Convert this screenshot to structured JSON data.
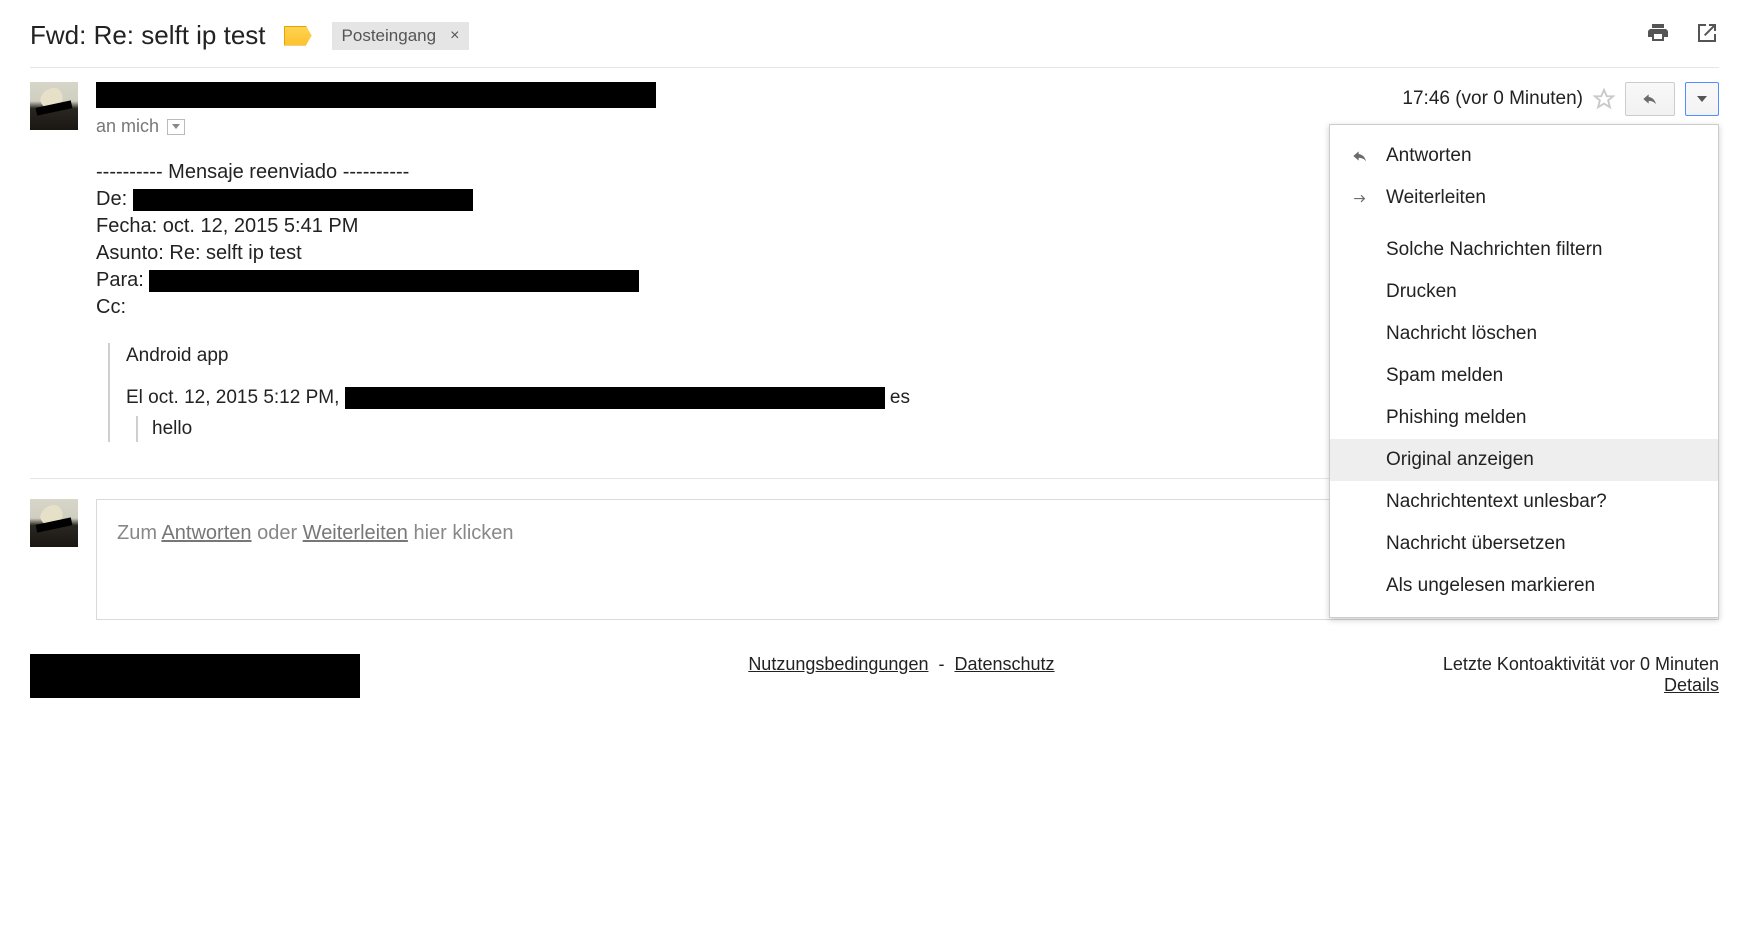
{
  "header": {
    "subject": "Fwd: Re: selft ip test",
    "inbox_label": "Posteingang"
  },
  "message": {
    "to_prefix": "an mich",
    "timestamp": "17:46 (vor 0 Minuten)",
    "forward_divider": "---------- Mensaje reenviado ----------",
    "from_label": "De:",
    "date_line": "Fecha: oct. 12, 2015 5:41 PM",
    "subject_line": "Asunto: Re: selft ip test",
    "to_label": "Para:",
    "cc_line": "Cc:",
    "quoted_line1": "Android app",
    "quoted_line2_pre": "El oct. 12, 2015 5:12 PM, ",
    "quoted_line2_post": " es",
    "quoted_inner": "hello"
  },
  "reply_box": {
    "pre": "Zum ",
    "reply_link": "Antworten",
    "mid": " oder ",
    "forward_link": "Weiterleiten",
    "post": " hier klicken"
  },
  "menu": {
    "reply": "Antworten",
    "forward": "Weiterleiten",
    "filter": "Solche Nachrichten filtern",
    "print": "Drucken",
    "delete": "Nachricht löschen",
    "spam": "Spam melden",
    "phishing": "Phishing melden",
    "show_original": "Original anzeigen",
    "garbled": "Nachrichtentext unlesbar?",
    "translate": "Nachricht übersetzen",
    "mark_unread": "Als ungelesen markieren"
  },
  "footer": {
    "terms": "Nutzungsbedingungen",
    "sep": " - ",
    "privacy": "Datenschutz",
    "activity": "Letzte Kontoaktivität vor 0 Minuten",
    "details": "Details"
  }
}
